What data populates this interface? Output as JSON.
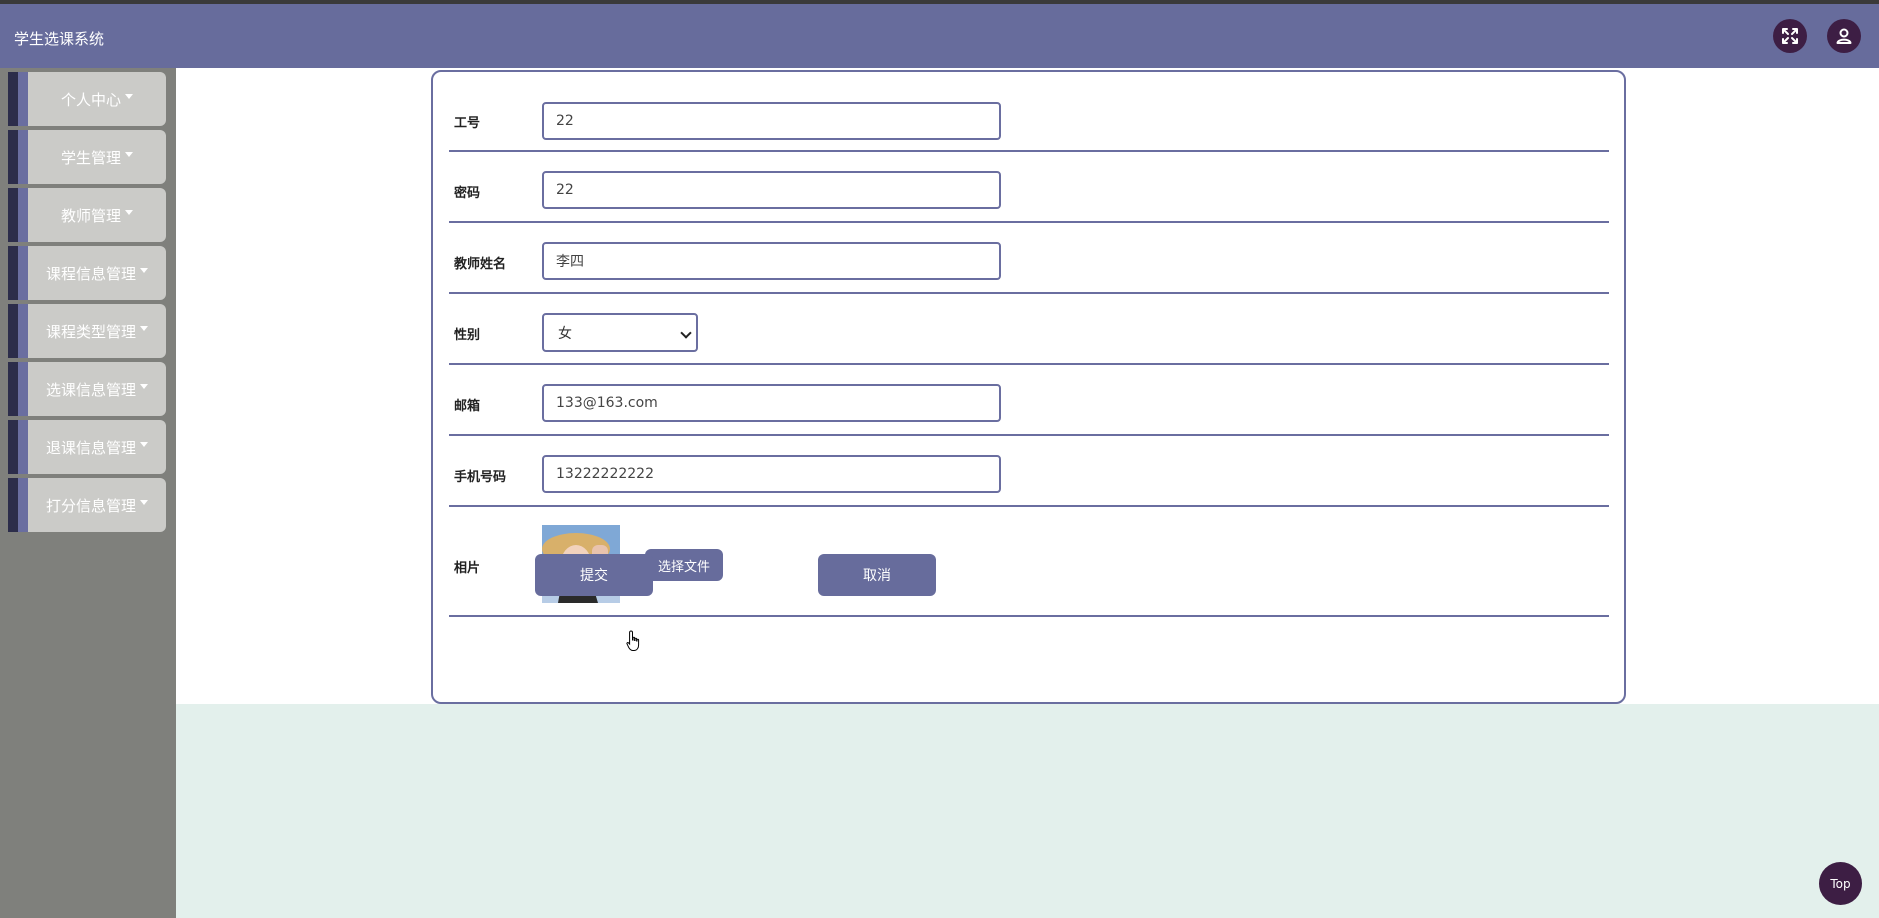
{
  "app": {
    "title": "学生选课系统"
  },
  "header": {
    "fullscreen_icon": "fullscreen-icon",
    "user_icon": "user-icon"
  },
  "sidebar": {
    "items": [
      {
        "label": "个人中心"
      },
      {
        "label": "学生管理"
      },
      {
        "label": "教师管理"
      },
      {
        "label": "课程信息管理"
      },
      {
        "label": "课程类型管理"
      },
      {
        "label": "选课信息管理"
      },
      {
        "label": "退课信息管理"
      },
      {
        "label": "打分信息管理"
      }
    ]
  },
  "form": {
    "fields": {
      "staff_id": {
        "label": "工号",
        "value": "22"
      },
      "password": {
        "label": "密码",
        "value": "22"
      },
      "teacher_name": {
        "label": "教师姓名",
        "value": "李四"
      },
      "gender": {
        "label": "性别",
        "value": "女"
      },
      "email": {
        "label": "邮箱",
        "value": "133@163.com"
      },
      "phone": {
        "label": "手机号码",
        "value": "13222222222"
      },
      "photo": {
        "label": "相片",
        "choose_file": "选择文件"
      }
    },
    "submit_label": "提交",
    "cancel_label": "取消"
  },
  "top_button": {
    "label": "Top"
  },
  "colors": {
    "header": "#676c9c",
    "sidebar": "#7f807c",
    "accent_dark": "#3d1e44",
    "footer_bg": "#e3f0ec"
  }
}
